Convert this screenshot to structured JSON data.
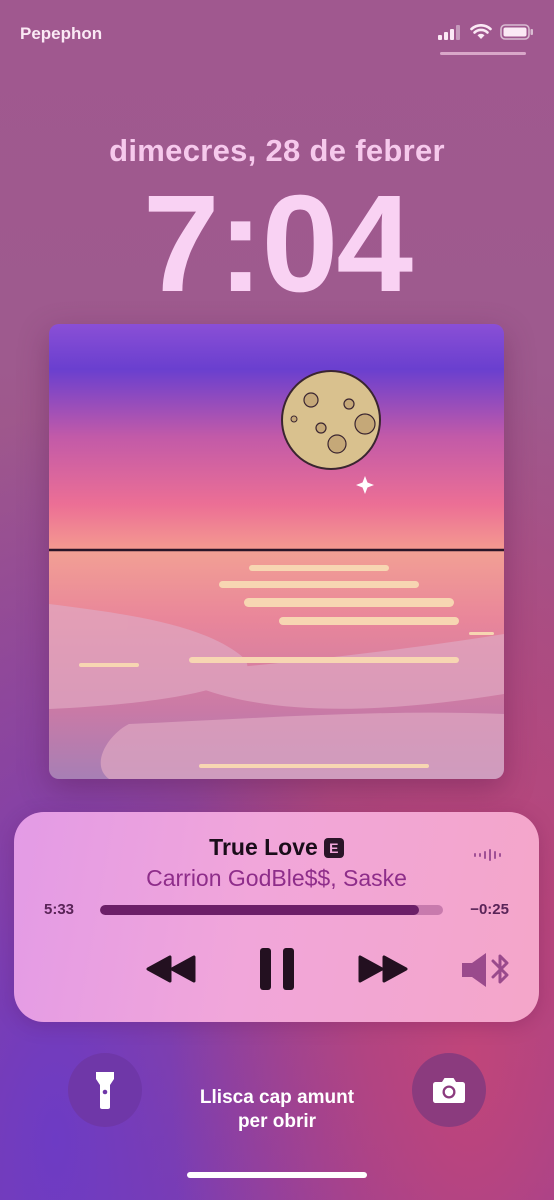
{
  "status_bar": {
    "carrier": "Pepephon",
    "icons": [
      "cellular-signal-icon",
      "wifi-icon",
      "battery-icon"
    ]
  },
  "lock_screen": {
    "date": "dimecres, 28 de febrer",
    "time": "7:04",
    "unlock_hint_line1": "Llisca cap amunt",
    "unlock_hint_line2": "per obrir"
  },
  "now_playing": {
    "title": "True Love",
    "explicit_badge": "E",
    "artist": "Carrion GodBle$$, Saske",
    "elapsed": "5:33",
    "remaining": "−0:25",
    "progress_fraction": 0.93,
    "controls": [
      "rewind-icon",
      "pause-icon",
      "fast-forward-icon",
      "speaker-bluetooth-icon"
    ]
  },
  "bottom_controls": [
    "flashlight-icon",
    "camera-icon"
  ],
  "colors": {
    "player_bg": "#f1a6da",
    "artist": "#8e2d8a",
    "progress_fill": "#6c1f68",
    "date_time": "#f9d2f3"
  }
}
